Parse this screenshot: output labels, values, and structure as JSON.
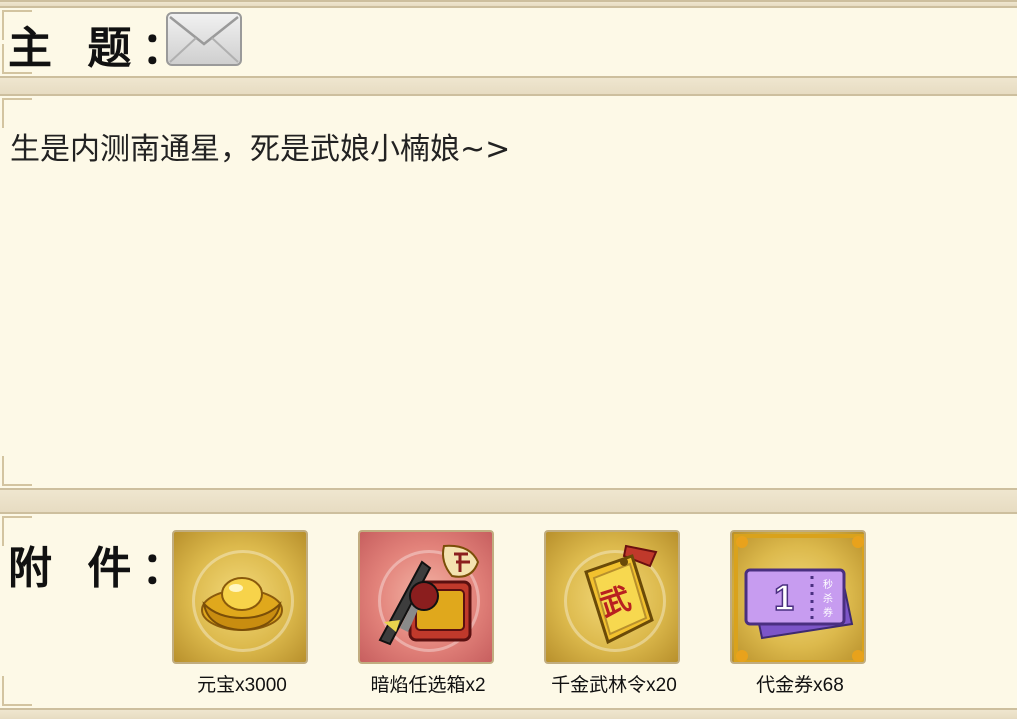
{
  "subject": {
    "label": "主 题：",
    "icon": "envelope-icon"
  },
  "body": {
    "text": "生是内测南通星，死是武娘小楠娘~>"
  },
  "attachments": {
    "label": "附 件：",
    "items": [
      {
        "name": "元宝x3000",
        "icon": "gold-ingot-icon",
        "frame_color": "#dcb94c"
      },
      {
        "name": "暗焰任选箱x2",
        "icon": "epic-chest-icon",
        "frame_color": "#e2827a"
      },
      {
        "name": "千金武林令x20",
        "icon": "wulin-token-icon",
        "frame_color": "#dcb94c"
      },
      {
        "name": "代金券x68",
        "icon": "voucher-icon",
        "frame_color": "#dcb94c"
      }
    ]
  },
  "colors": {
    "background": "#fdf9e7",
    "border": "#cdbf9e",
    "text": "#222222"
  }
}
